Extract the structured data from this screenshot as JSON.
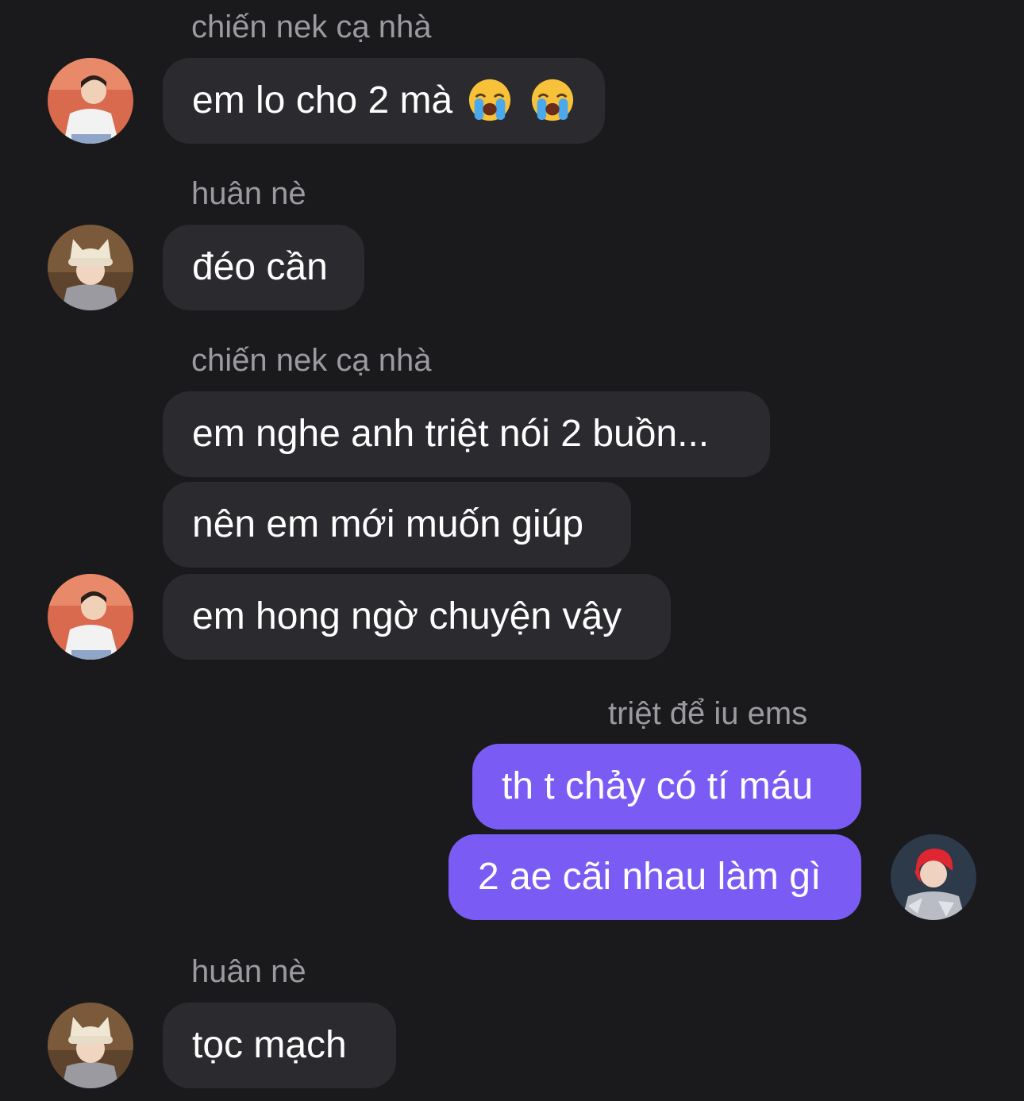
{
  "messages": [
    {
      "sender": "chiến nek cạ nhà",
      "text": "em lo cho 2 mà",
      "emojis": [
        "loudly-crying-face-icon",
        "loudly-crying-face-icon"
      ]
    },
    {
      "sender": "huân nè",
      "text": "đéo cần"
    },
    {
      "sender": "chiến nek cạ nhà",
      "texts": [
        "em nghe anh triệt nói 2 buồn...",
        "nên em mới muốn giúp",
        "em hong ngờ chuyện vậy"
      ]
    },
    {
      "sender": "triệt để iu ems",
      "texts": [
        "th t chảy có tí máu",
        "2 ae cãi nhau làm gì"
      ],
      "mine": true
    },
    {
      "sender": "huân nè",
      "text": "tọc mạch"
    }
  ],
  "colors": {
    "background": "#1a1a1c",
    "incoming_bubble": "#2b2b2f",
    "outgoing_bubble": "#7a5cf5",
    "sender_text": "#9a9aa0",
    "message_text": "#ffffff"
  },
  "icons": {
    "avatar_chien": "avatar-chien-icon",
    "avatar_huan": "avatar-huan-icon",
    "avatar_triet": "avatar-triet-icon",
    "emoji": "loudly-crying-face-icon"
  }
}
